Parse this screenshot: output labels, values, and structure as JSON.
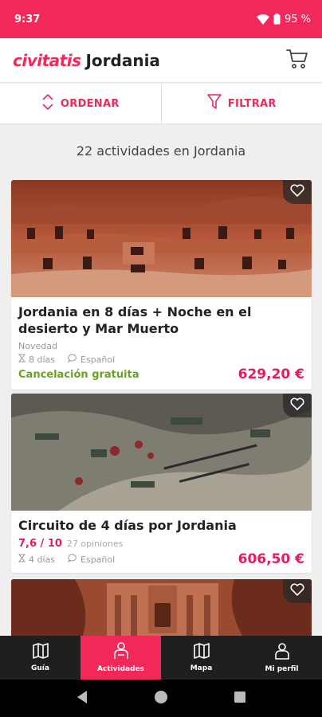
{
  "status": {
    "time": "9:37",
    "battery": "95 %"
  },
  "header": {
    "logo": "civitatis",
    "title": "Jordania",
    "icon": "cart-icon"
  },
  "sort_bar": {
    "order_label": "ORDENAR",
    "filter_label": "FILTRAR"
  },
  "results": {
    "count_text": "22 actividades en Jordania"
  },
  "cards": [
    {
      "title": "Jordania en 8 días + Noche en el desierto y Mar Muerto",
      "tag": "Novedad",
      "duration": "8 días",
      "language": "Español",
      "cancellation": "Cancelación gratuita",
      "price": "629,20 €"
    },
    {
      "title": "Circuito de 4 días por Jordania",
      "rating": "7,6 / 10",
      "opinions": "27 opiniones",
      "duration": "4 días",
      "language": "Español",
      "price": "606,50 €"
    }
  ],
  "bottom_nav": [
    {
      "label": "Guía",
      "icon": "map-book-icon"
    },
    {
      "label": "Actividades",
      "icon": "person-icon",
      "active": true
    },
    {
      "label": "Mapa",
      "icon": "map-icon"
    },
    {
      "label": "Mi perfil",
      "icon": "profile-icon"
    }
  ],
  "colors": {
    "accent": "#f2285a",
    "price": "#e31c5c",
    "cancellation": "#6aa21f",
    "nav_bg": "#1f1f1f"
  }
}
